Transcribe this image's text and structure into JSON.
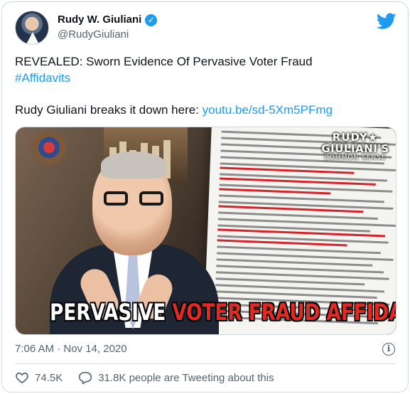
{
  "tweet": {
    "author": {
      "display_name": "Rudy W. Giuliani",
      "handle": "@RudyGiuliani",
      "verified": true
    },
    "text_line_1": "REVEALED: Sworn Evidence Of Pervasive Voter Fraud",
    "hashtag": "#Affidavits",
    "text_line_3_prefix": "Rudy Giuliani breaks it down here: ",
    "link": "youtu.be/sd-5Xm5PFmg",
    "media": {
      "brand_line_1": "RUDY★",
      "brand_line_2": "GIULIANI'S",
      "brand_line_3": "COMMON SENSE",
      "caption_white": "PERVASIVE ",
      "caption_red": "VOTER FRAUD AFFIDAVITS"
    },
    "timestamp": "7:06 AM · Nov 14, 2020",
    "likes": "74.5K",
    "replies_text": "31.8K people are Tweeting about this"
  },
  "icons": {
    "platform": "twitter-bird-icon",
    "verified": "verified-badge-icon",
    "info": "info-icon",
    "like": "heart-icon",
    "reply": "speech-bubble-icon"
  },
  "colors": {
    "accent": "#1d9bf0",
    "muted": "#536471",
    "caption_red": "#e02a22"
  }
}
